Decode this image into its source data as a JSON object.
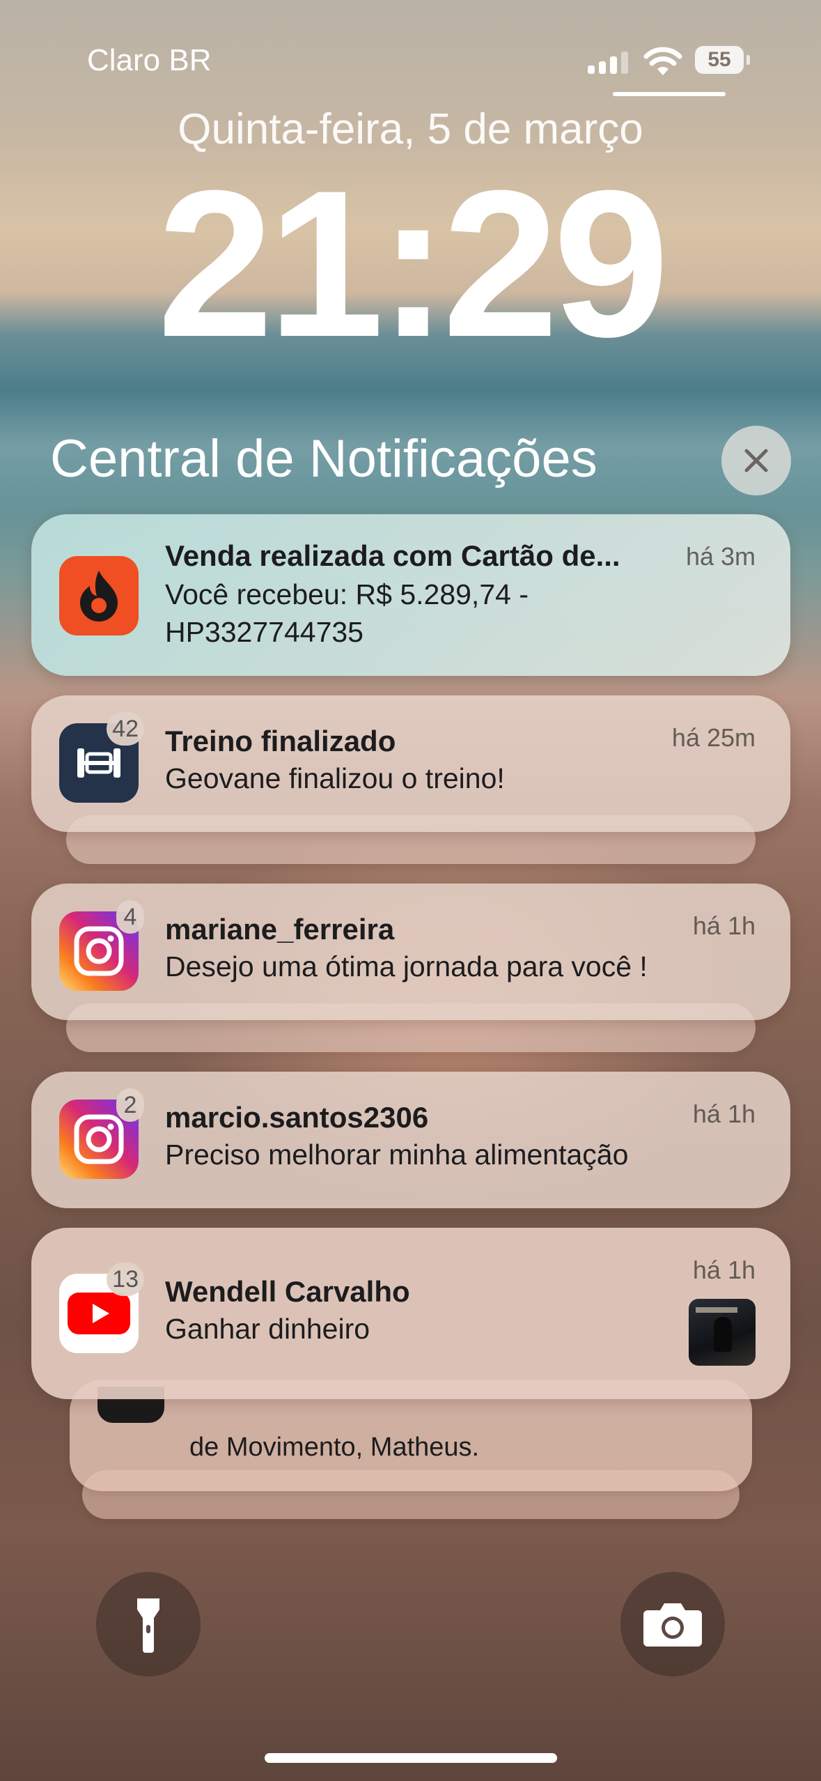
{
  "status_bar": {
    "carrier": "Claro BR",
    "battery": "55"
  },
  "lock_screen": {
    "date": "Quinta-feira, 5 de março",
    "time": "21:29"
  },
  "notification_center": {
    "title": "Central de Notificações",
    "close_icon": "close-icon"
  },
  "notifications": [
    {
      "app": "hotmart",
      "icon": "flame-icon",
      "title": "Venda realizada com Cartão de...",
      "body_lines": [
        "Você recebeu: R$ 5.289,74 -",
        "HP3327744735"
      ],
      "time": "há 3m",
      "badge": ""
    },
    {
      "app": "workout",
      "icon": "dumbbell-icon",
      "title": "Treino finalizado",
      "body_lines": [
        "Geovane finalizou o treino!"
      ],
      "time": "há 25m",
      "badge": "42"
    },
    {
      "app": "instagram",
      "icon": "instagram-icon",
      "title": "mariane_ferreira",
      "body_lines": [
        "Desejo uma ótima jornada para você !"
      ],
      "time": "há 1h",
      "badge": "4"
    },
    {
      "app": "instagram",
      "icon": "instagram-icon",
      "title": "marcio.santos2306",
      "body_lines": [
        "Preciso melhorar minha alimentação"
      ],
      "time": "há 1h",
      "badge": "2"
    },
    {
      "app": "youtube",
      "icon": "youtube-icon",
      "title": "Wendell Carvalho",
      "body_lines": [
        "Ganhar dinheiro"
      ],
      "time": "há 1h",
      "badge": "13"
    }
  ],
  "stacked_partial": {
    "body": "de Movimento, Matheus."
  },
  "bottom_controls": {
    "flashlight_icon": "flashlight-icon",
    "camera_icon": "camera-icon"
  },
  "colors": {
    "hotmart": "#F04E23",
    "workout": "#24324A",
    "youtube": "#FF0000"
  }
}
